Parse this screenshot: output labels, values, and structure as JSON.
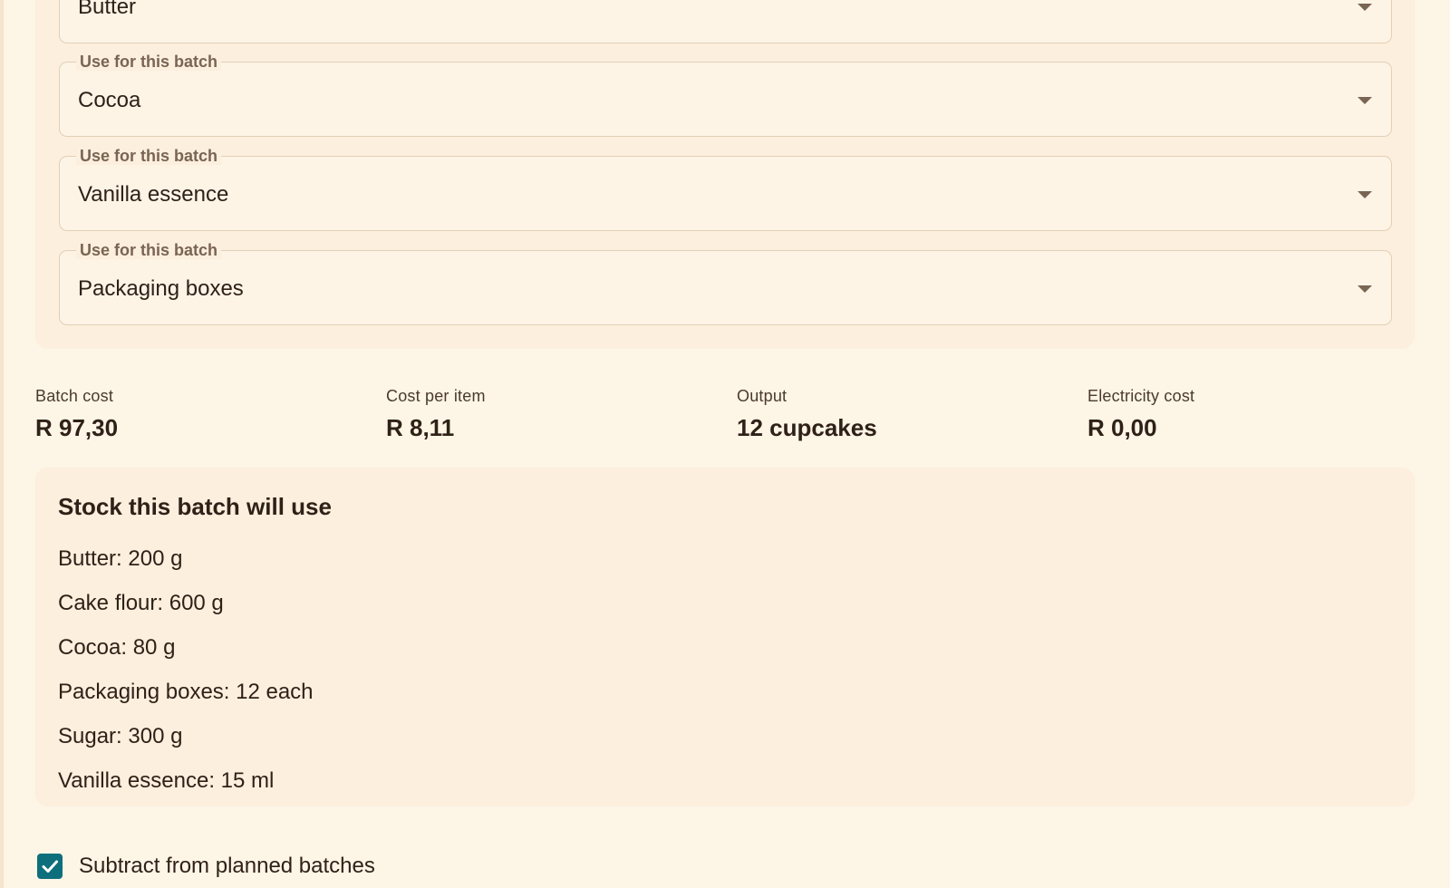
{
  "ingredient_selects": [
    {
      "legend": "",
      "value": "Butter"
    },
    {
      "legend": "Use for this batch",
      "value": "Cocoa"
    },
    {
      "legend": "Use for this batch",
      "value": "Vanilla essence"
    },
    {
      "legend": "Use for this batch",
      "value": "Packaging boxes"
    }
  ],
  "summary": {
    "batch_cost": {
      "label": "Batch cost",
      "value": "R 97,30"
    },
    "cost_per_item": {
      "label": "Cost per item",
      "value": "R 8,11"
    },
    "output": {
      "label": "Output",
      "value": "12 cupcakes"
    },
    "electricity_cost": {
      "label": "Electricity cost",
      "value": "R 0,00"
    }
  },
  "stock": {
    "title": "Stock this batch will use",
    "items": [
      "Butter: 200 g",
      "Cake flour: 600 g",
      "Cocoa: 80 g",
      "Packaging boxes: 12 each",
      "Sugar: 300 g",
      "Vanilla essence: 15 ml"
    ]
  },
  "subtract": {
    "label": "Subtract from planned batches",
    "checked": true
  },
  "colors": {
    "background": "#fdf5e6",
    "panel": "#fcefdd",
    "accent": "#0e6f7c",
    "text": "#2f2118"
  },
  "icons": {
    "select_arrow": "chevron-down-icon",
    "checkbox_check": "check-icon"
  }
}
